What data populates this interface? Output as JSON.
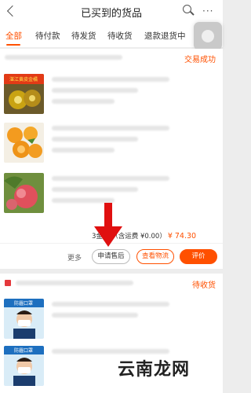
{
  "header": {
    "title": "已买到的货品",
    "more_glyph": "···"
  },
  "tabs": [
    {
      "label": "全部",
      "active": true
    },
    {
      "label": "待付款"
    },
    {
      "label": "待发货"
    },
    {
      "label": "待收货"
    },
    {
      "label": "退款退货中"
    }
  ],
  "orders": [
    {
      "status": "交易成功",
      "summary_prefix": "3",
      "summary_text": "金额:（含运费 ¥0.00）",
      "price": "¥ 74.30",
      "actions": {
        "more": "更多",
        "apply_after_sale": "申请售后",
        "view_logistics": "查看物流",
        "review": "评价"
      },
      "thumb1_caption": "湛江黄皮金橘"
    },
    {
      "status": "待收货",
      "thumb_caption": "防霾口罩"
    }
  ],
  "watermark": "云南龙网",
  "colors": {
    "accent": "#ff5000",
    "arrow": "#e01010"
  }
}
